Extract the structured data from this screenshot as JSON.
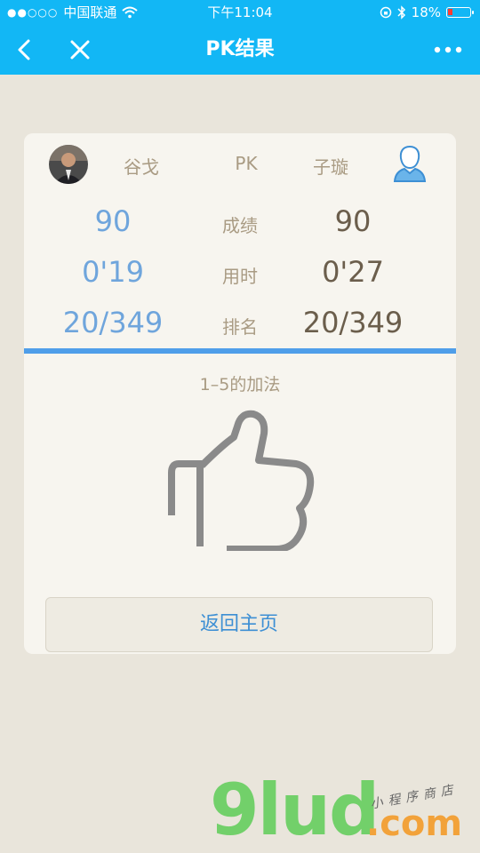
{
  "status_bar": {
    "signal": "●●○○○",
    "carrier": "中国联通",
    "time": "下午11:04",
    "battery": "18%",
    "icons": [
      "wifi-icon",
      "rotation-lock-icon",
      "bluetooth-icon",
      "battery-icon"
    ]
  },
  "nav": {
    "title": "PK结果",
    "back_icon": "chevron-left-icon",
    "close_icon": "close-icon",
    "more_icon": "more-dots-icon"
  },
  "pk": {
    "player1": "谷戈",
    "vs": "PK",
    "player2": "子璇",
    "rows": [
      {
        "label": "成绩",
        "left": "90",
        "right": "90"
      },
      {
        "label": "用时",
        "left": "0'19",
        "right": "0'27"
      },
      {
        "label": "排名",
        "left": "20/349",
        "right": "20/349"
      }
    ],
    "subject": "1–5的加法",
    "result_icon": "thumbs-up-icon"
  },
  "home_button": "返回主页",
  "watermark": {
    "main": "9lud",
    "domain": ".com",
    "tag": "小程序商店"
  },
  "colors": {
    "nav_bg": "#12b7f5",
    "accent_blue": "#4f9ee9",
    "left_value": "#6fa5dc",
    "right_value": "#6b5e4c",
    "label": "#a99b83",
    "page_bg": "#e9e5db",
    "card_bg": "#f7f5ef"
  }
}
